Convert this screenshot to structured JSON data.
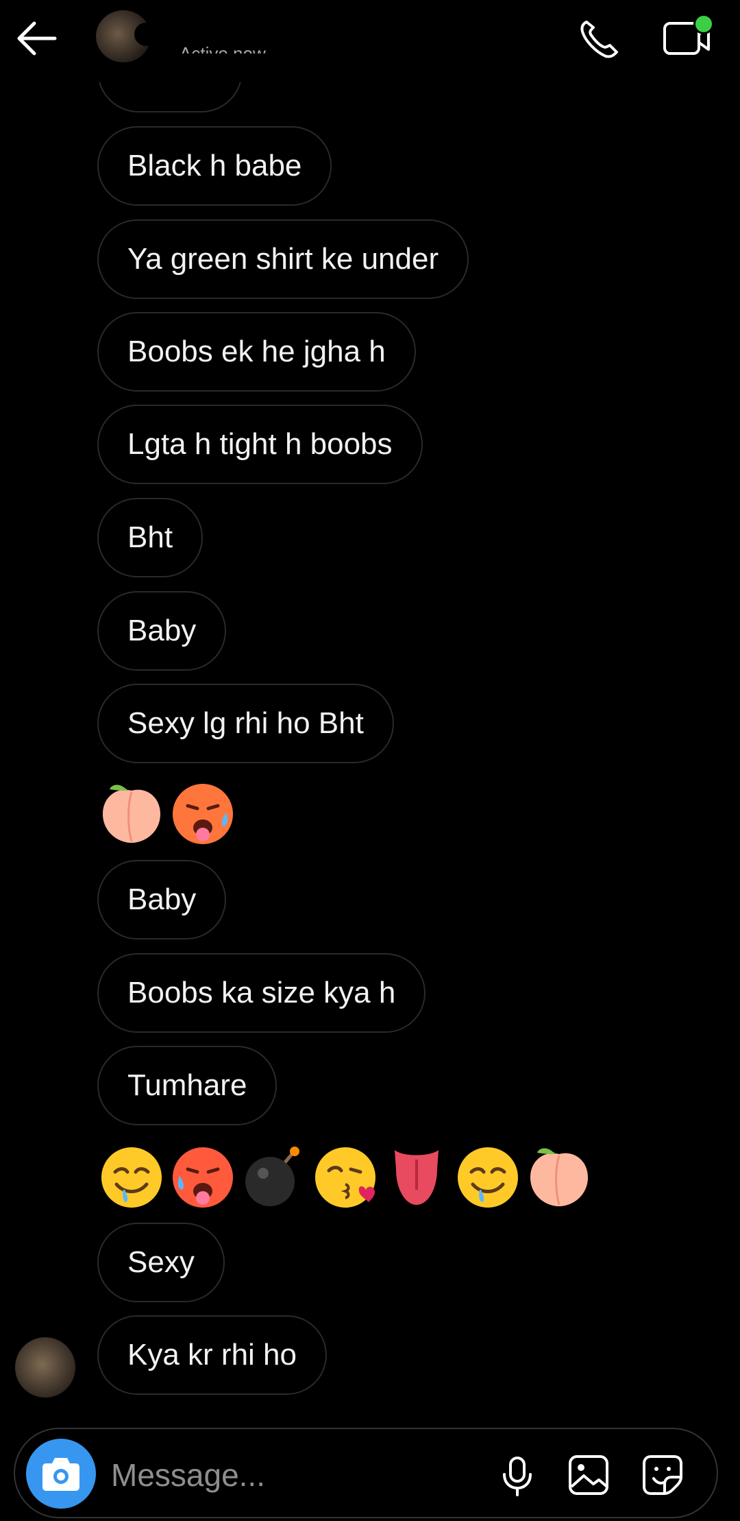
{
  "header": {
    "status": "Active now"
  },
  "messages": [
    {
      "text": "Black h babe"
    },
    {
      "text": "Ya green shirt ke under"
    },
    {
      "text": "Boobs ek he jgha h"
    },
    {
      "text": "Lgta h tight h boobs"
    },
    {
      "text": "Bht"
    },
    {
      "text": "Baby"
    },
    {
      "text": "Sexy lg rhi ho Bht"
    },
    {
      "emojis": [
        "peach",
        "hot-face"
      ]
    },
    {
      "text": "Baby"
    },
    {
      "text": "Boobs ka size kya h"
    },
    {
      "text": "Tumhare"
    },
    {
      "emojis": [
        "drooling-face",
        "hot-face",
        "bomb",
        "kissing-heart-face",
        "tongue",
        "drooling-face",
        "peach"
      ]
    },
    {
      "text": "Sexy"
    },
    {
      "text": "Kya kr rhi ho"
    }
  ],
  "composer": {
    "placeholder": "Message..."
  },
  "icons": {
    "back": "arrow-left-icon",
    "call": "phone-icon",
    "video": "video-icon",
    "camera": "camera-icon",
    "mic": "microphone-icon",
    "gallery": "image-icon",
    "sticker": "sticker-icon"
  },
  "colors": {
    "accent": "#3797f0",
    "online": "#3ccf45",
    "bubble_border": "#2a2a2a"
  }
}
